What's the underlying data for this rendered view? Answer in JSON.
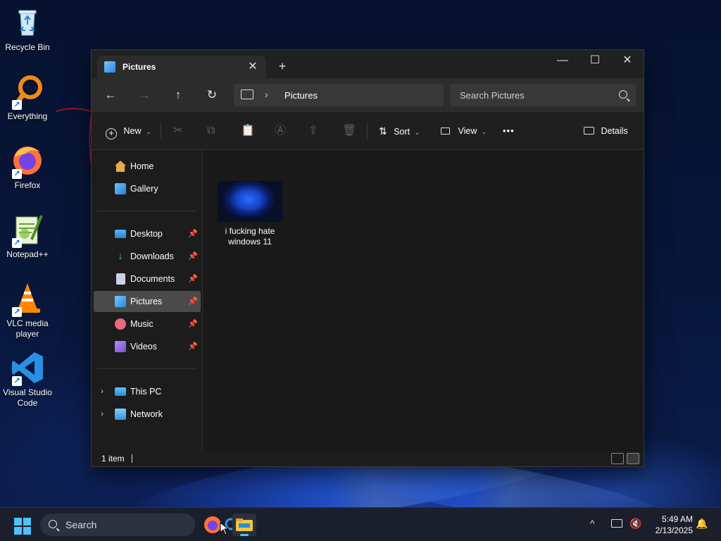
{
  "desktop": {
    "icons": [
      {
        "label": "Recycle Bin",
        "icon": "recycle-bin-icon"
      },
      {
        "label": "Everything",
        "icon": "everything-search-icon"
      },
      {
        "label": "Firefox",
        "icon": "firefox-icon"
      },
      {
        "label": "Notepad++",
        "icon": "notepad-plus-plus-icon"
      },
      {
        "label": "VLC media player",
        "icon": "vlc-icon"
      },
      {
        "label": "Visual Studio Code",
        "icon": "vscode-icon"
      }
    ]
  },
  "explorer": {
    "tab_title": "Pictures",
    "tab_close": "✕",
    "new_tab": "+",
    "window_controls": {
      "minimize": "—",
      "maximize": "☐",
      "close": "✕"
    },
    "nav_buttons": {
      "back": "←",
      "forward": "→",
      "up": "↑",
      "refresh": "↻"
    },
    "address": {
      "separator": "›",
      "crumb": "Pictures"
    },
    "search_placeholder": "Search Pictures",
    "toolbar": {
      "new_label": "New",
      "sort_label": "Sort",
      "view_label": "View",
      "more_label": "•••",
      "details_label": "Details",
      "cut": "✂",
      "copy": "⧉",
      "paste": "📋",
      "rename": "Ⓐ",
      "share": "⇪",
      "delete": "🗑"
    },
    "nav_pane": {
      "quick": [
        {
          "label": "Home",
          "icon": "home-icon",
          "pinned": false
        },
        {
          "label": "Gallery",
          "icon": "gallery-icon",
          "pinned": false
        }
      ],
      "pinned": [
        {
          "label": "Desktop",
          "icon": "desktop-folder-icon",
          "pin": "📌"
        },
        {
          "label": "Downloads",
          "icon": "downloads-icon",
          "pin": "📌"
        },
        {
          "label": "Documents",
          "icon": "documents-icon",
          "pin": "📌"
        },
        {
          "label": "Pictures",
          "icon": "pictures-icon",
          "pin": "📌",
          "selected": true
        },
        {
          "label": "Music",
          "icon": "music-icon",
          "pin": "📌"
        },
        {
          "label": "Videos",
          "icon": "videos-icon",
          "pin": "📌"
        }
      ],
      "locations": [
        {
          "label": "This PC",
          "icon": "this-pc-icon",
          "expander": "›"
        },
        {
          "label": "Network",
          "icon": "network-icon",
          "expander": "›"
        }
      ]
    },
    "files": [
      {
        "name": "i fucking hate windows 11",
        "name_line1": "i fucking hate",
        "name_line2": "windows 11"
      }
    ],
    "status": "1 item"
  },
  "taskbar": {
    "search_placeholder": "Search",
    "apps": [
      "firefox-icon",
      "everything-search-icon",
      "file-explorer-icon"
    ],
    "tray": {
      "chevron": "^"
    },
    "time": "5:49 AM",
    "date": "2/13/2025"
  }
}
